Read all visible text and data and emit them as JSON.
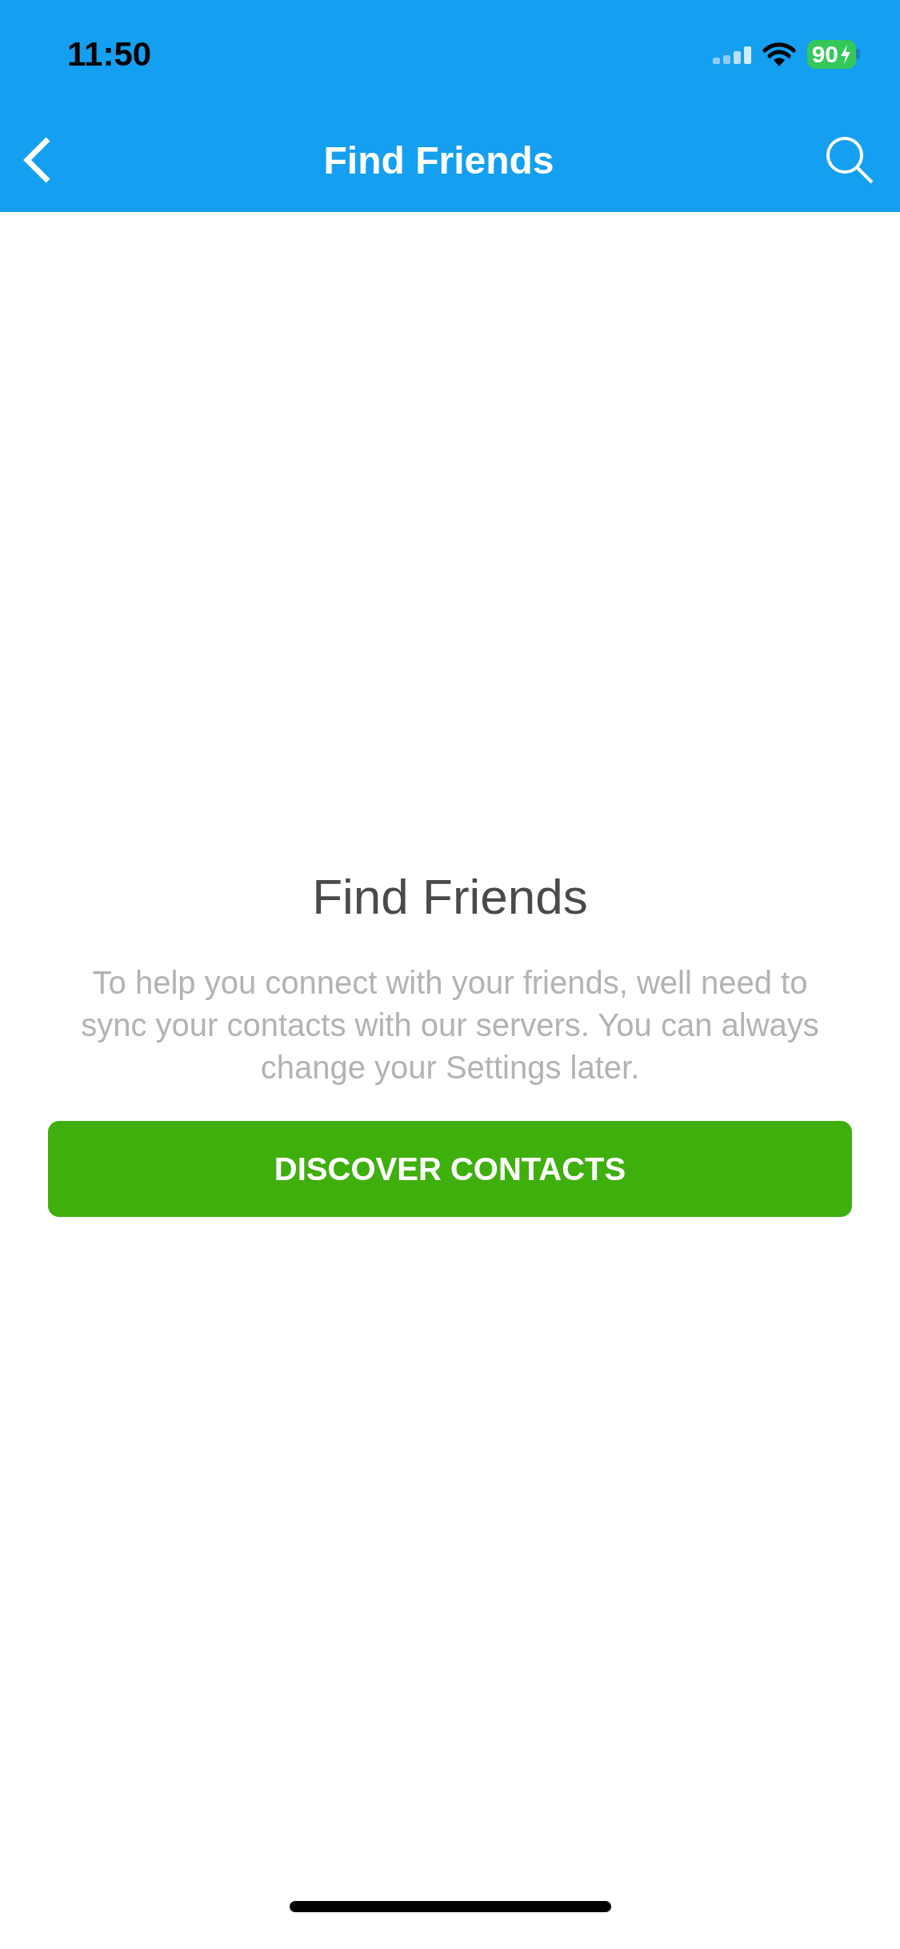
{
  "status_bar": {
    "time": "11:50",
    "battery": "90"
  },
  "nav_bar": {
    "title": "Find Friends"
  },
  "content": {
    "heading": "Find Friends",
    "message": "To help you connect with your friends, well need to sync your contacts with our servers. You can always change your Settings later.",
    "button": "DISCOVER CONTACTS"
  }
}
